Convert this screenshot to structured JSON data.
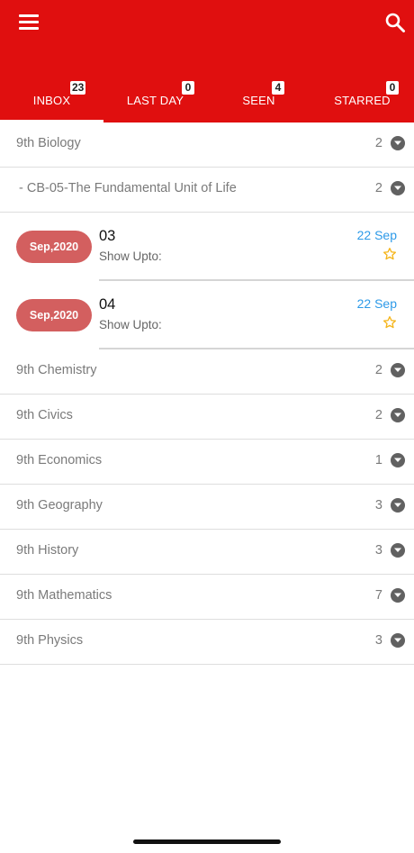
{
  "tabs": [
    {
      "label": "INBOX",
      "badge": "23"
    },
    {
      "label": "LAST DAY",
      "badge": "0"
    },
    {
      "label": "SEEN",
      "badge": "4"
    },
    {
      "label": "STARRED",
      "badge": "0"
    }
  ],
  "subjects_top": [
    {
      "title": "9th Biology",
      "count": "2"
    },
    {
      "title": "- CB-05-The Fundamental Unit of Life",
      "count": "2"
    }
  ],
  "messages": [
    {
      "pill": "Sep,2020",
      "title": "03",
      "subtitle": "Show Upto:",
      "date": "22 Sep"
    },
    {
      "pill": "Sep,2020",
      "title": "04",
      "subtitle": "Show Upto:",
      "date": "22 Sep"
    }
  ],
  "subjects": [
    {
      "title": "9th Chemistry",
      "count": "2"
    },
    {
      "title": "9th Civics",
      "count": "2"
    },
    {
      "title": "9th Economics",
      "count": "1"
    },
    {
      "title": "9th Geography",
      "count": "3"
    },
    {
      "title": "9th History",
      "count": "3"
    },
    {
      "title": "9th Mathematics",
      "count": "7"
    },
    {
      "title": "9th Physics",
      "count": "3"
    }
  ],
  "colors": {
    "appbar": "#e00f0f",
    "pill": "#d35f5f",
    "date": "#2d9ae8",
    "star": "#f5b51b"
  },
  "icons": {
    "menu": "hamburger-menu-icon",
    "search": "search-icon",
    "expand": "chevron-down-circle-icon",
    "star": "star-outline-icon"
  }
}
